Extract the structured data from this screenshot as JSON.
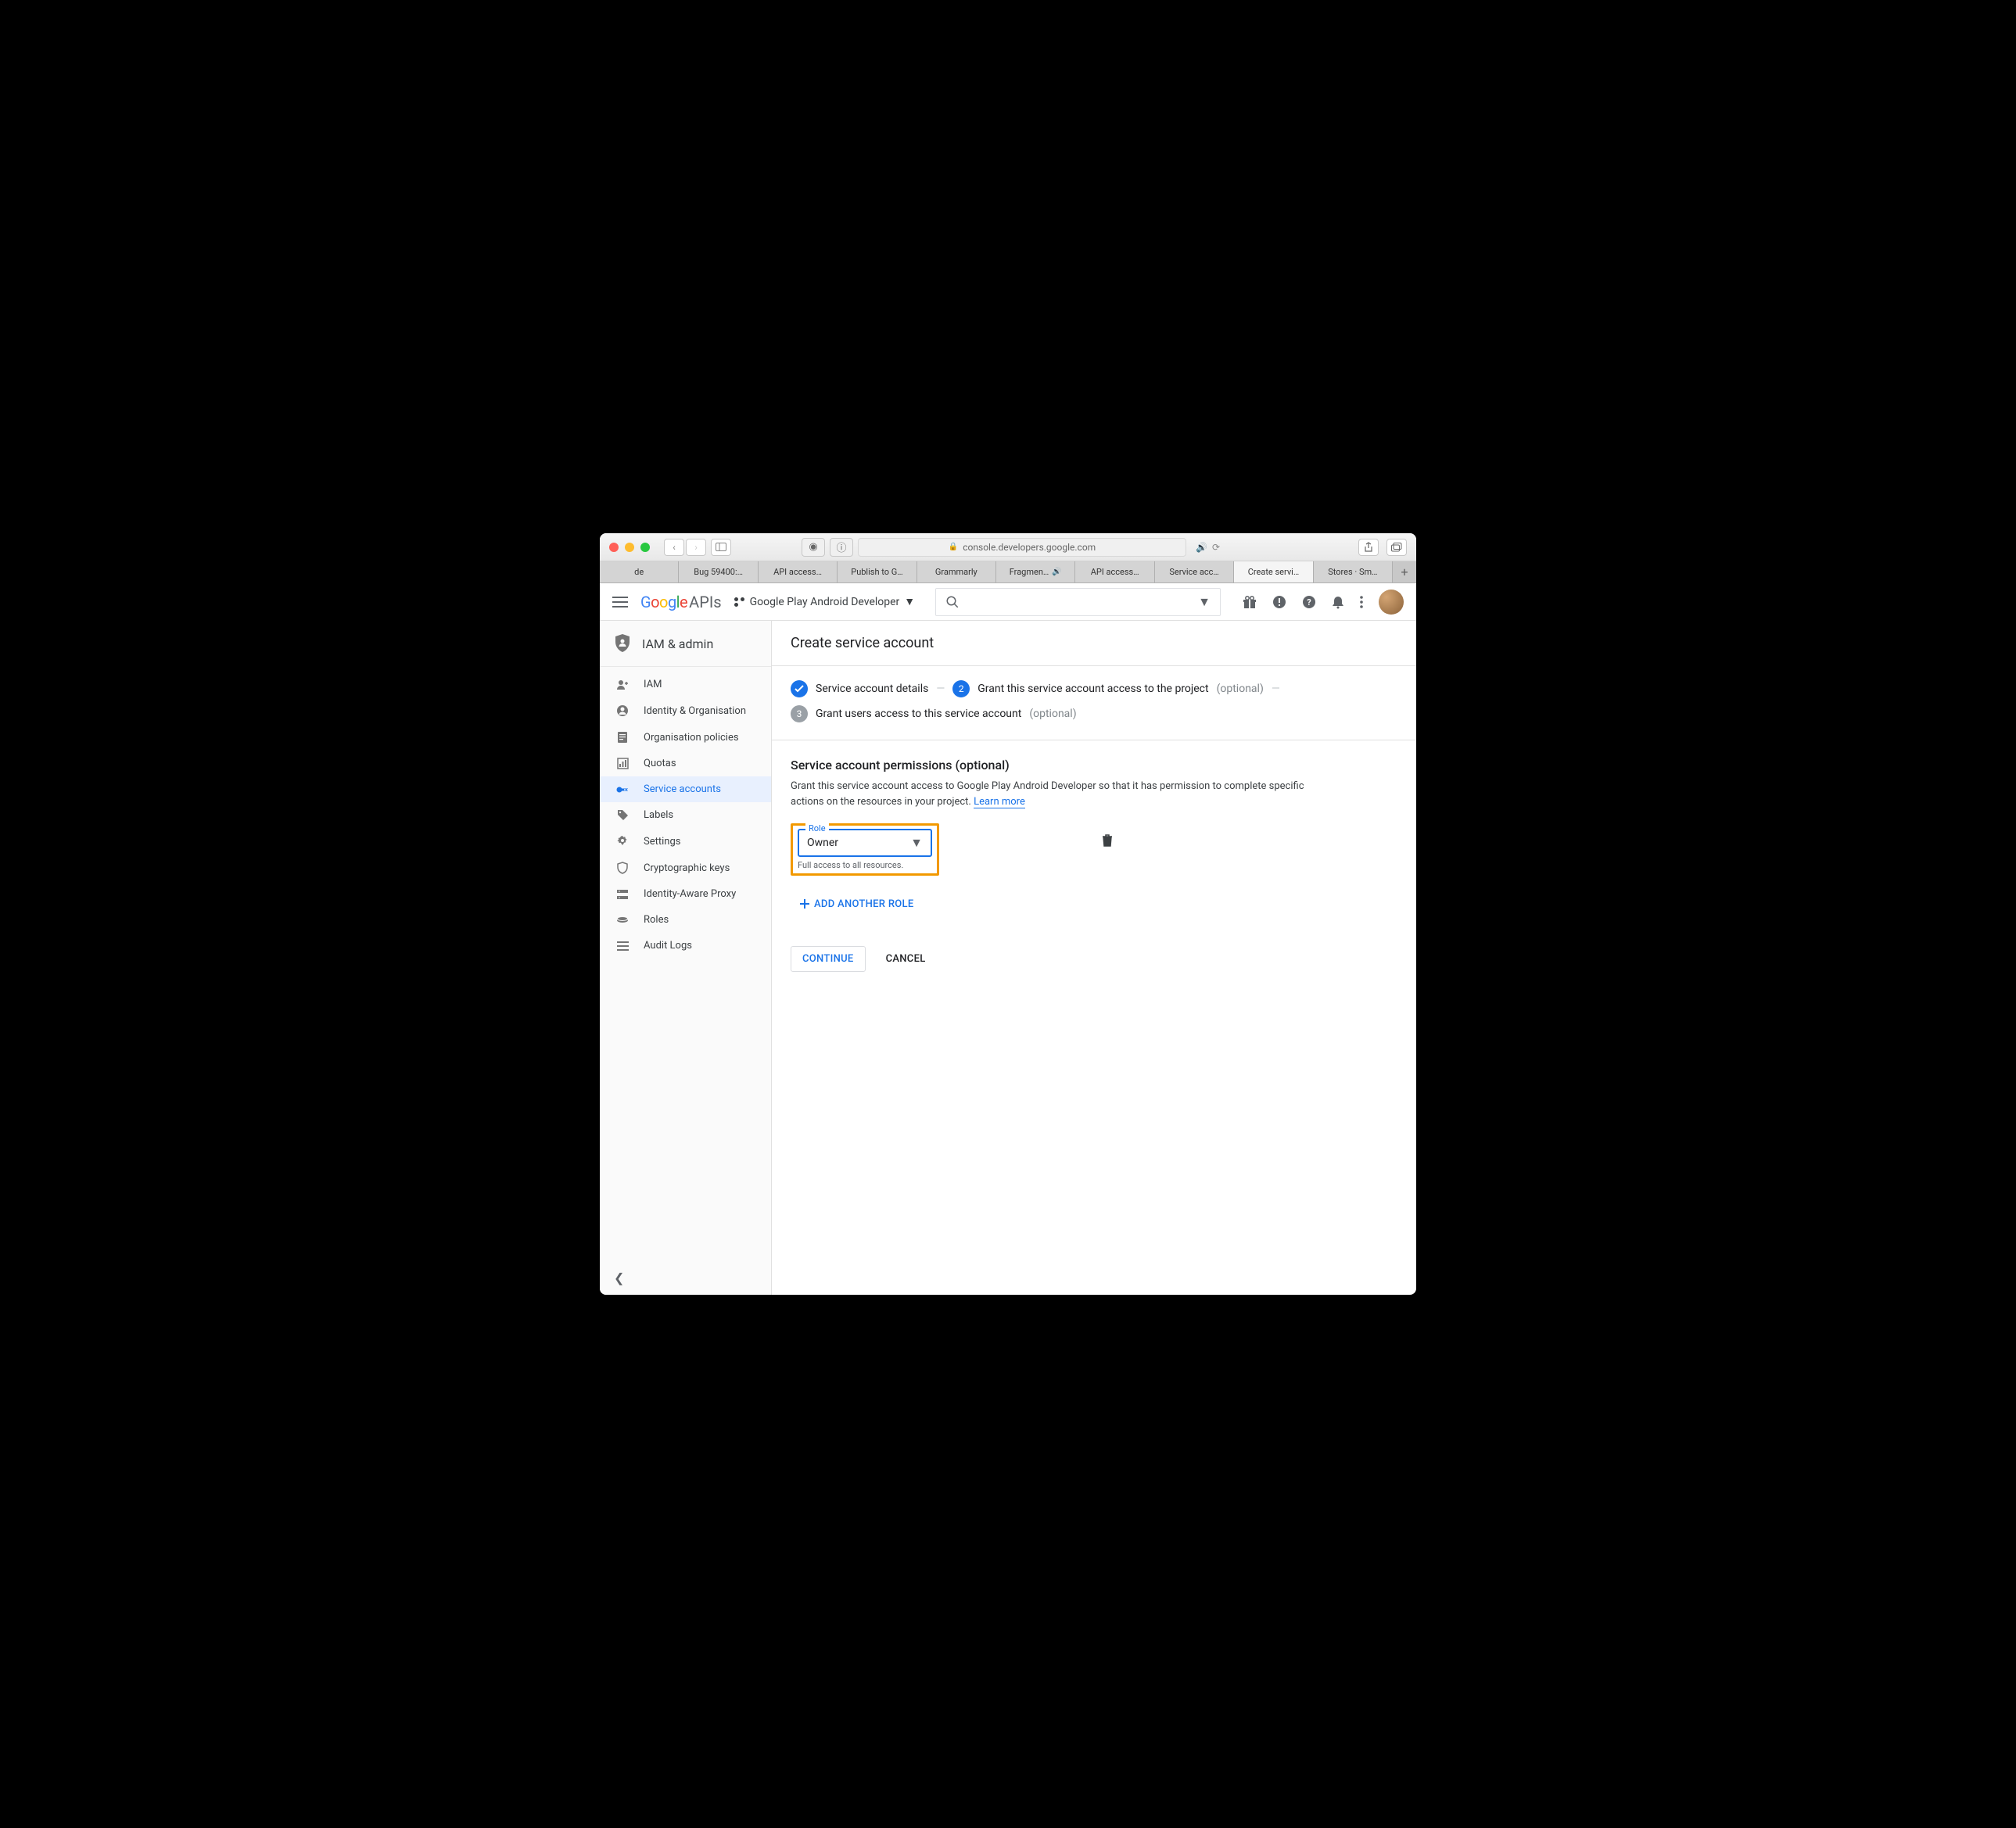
{
  "browser": {
    "address": "console.developers.google.com",
    "tabs": [
      {
        "label": "de",
        "active": false,
        "audio": false
      },
      {
        "label": "Bug 59400:…",
        "active": false,
        "audio": false
      },
      {
        "label": "API access…",
        "active": false,
        "audio": false
      },
      {
        "label": "Publish to G…",
        "active": false,
        "audio": false
      },
      {
        "label": "Grammarly",
        "active": false,
        "audio": false
      },
      {
        "label": "Fragmen…",
        "active": false,
        "audio": true
      },
      {
        "label": "API access…",
        "active": false,
        "audio": false
      },
      {
        "label": "Service acc…",
        "active": false,
        "audio": false
      },
      {
        "label": "Create servi…",
        "active": true,
        "audio": false
      },
      {
        "label": "Stores · Sm…",
        "active": false,
        "audio": false
      }
    ]
  },
  "header": {
    "logo_g": "G",
    "logo_o1": "o",
    "logo_o2": "o",
    "logo_g2": "g",
    "logo_l": "l",
    "logo_e": "e",
    "apis": "APIs",
    "project": "Google Play Android Developer"
  },
  "sidebar": {
    "title": "IAM & admin",
    "items": [
      {
        "icon": "person-add",
        "label": "IAM"
      },
      {
        "icon": "account",
        "label": "Identity & Organisation"
      },
      {
        "icon": "doc",
        "label": "Organisation policies"
      },
      {
        "icon": "quota",
        "label": "Quotas"
      },
      {
        "icon": "service",
        "label": "Service accounts"
      },
      {
        "icon": "tag",
        "label": "Labels"
      },
      {
        "icon": "gear",
        "label": "Settings"
      },
      {
        "icon": "shield",
        "label": "Cryptographic keys"
      },
      {
        "icon": "proxy",
        "label": "Identity-Aware Proxy"
      },
      {
        "icon": "roles",
        "label": "Roles"
      },
      {
        "icon": "list",
        "label": "Audit Logs"
      }
    ],
    "active_index": 4
  },
  "page": {
    "title": "Create service account",
    "steps": {
      "s1": "Service account details",
      "s2": "Grant this service account access to the project",
      "s2_opt": "(optional)",
      "s3": "Grant users access to this service account",
      "s3_opt": "(optional)",
      "n2": "2",
      "n3": "3"
    },
    "section": {
      "title": "Service account permissions (optional)",
      "desc1": "Grant this service account access to Google Play Android Developer so that it has permission to complete specific actions on the resources in your project. ",
      "learn": "Learn more"
    },
    "role": {
      "label": "Role",
      "value": "Owner",
      "help": "Full access to all resources."
    },
    "add_role": "ADD ANOTHER ROLE",
    "continue": "CONTINUE",
    "cancel": "CANCEL"
  }
}
